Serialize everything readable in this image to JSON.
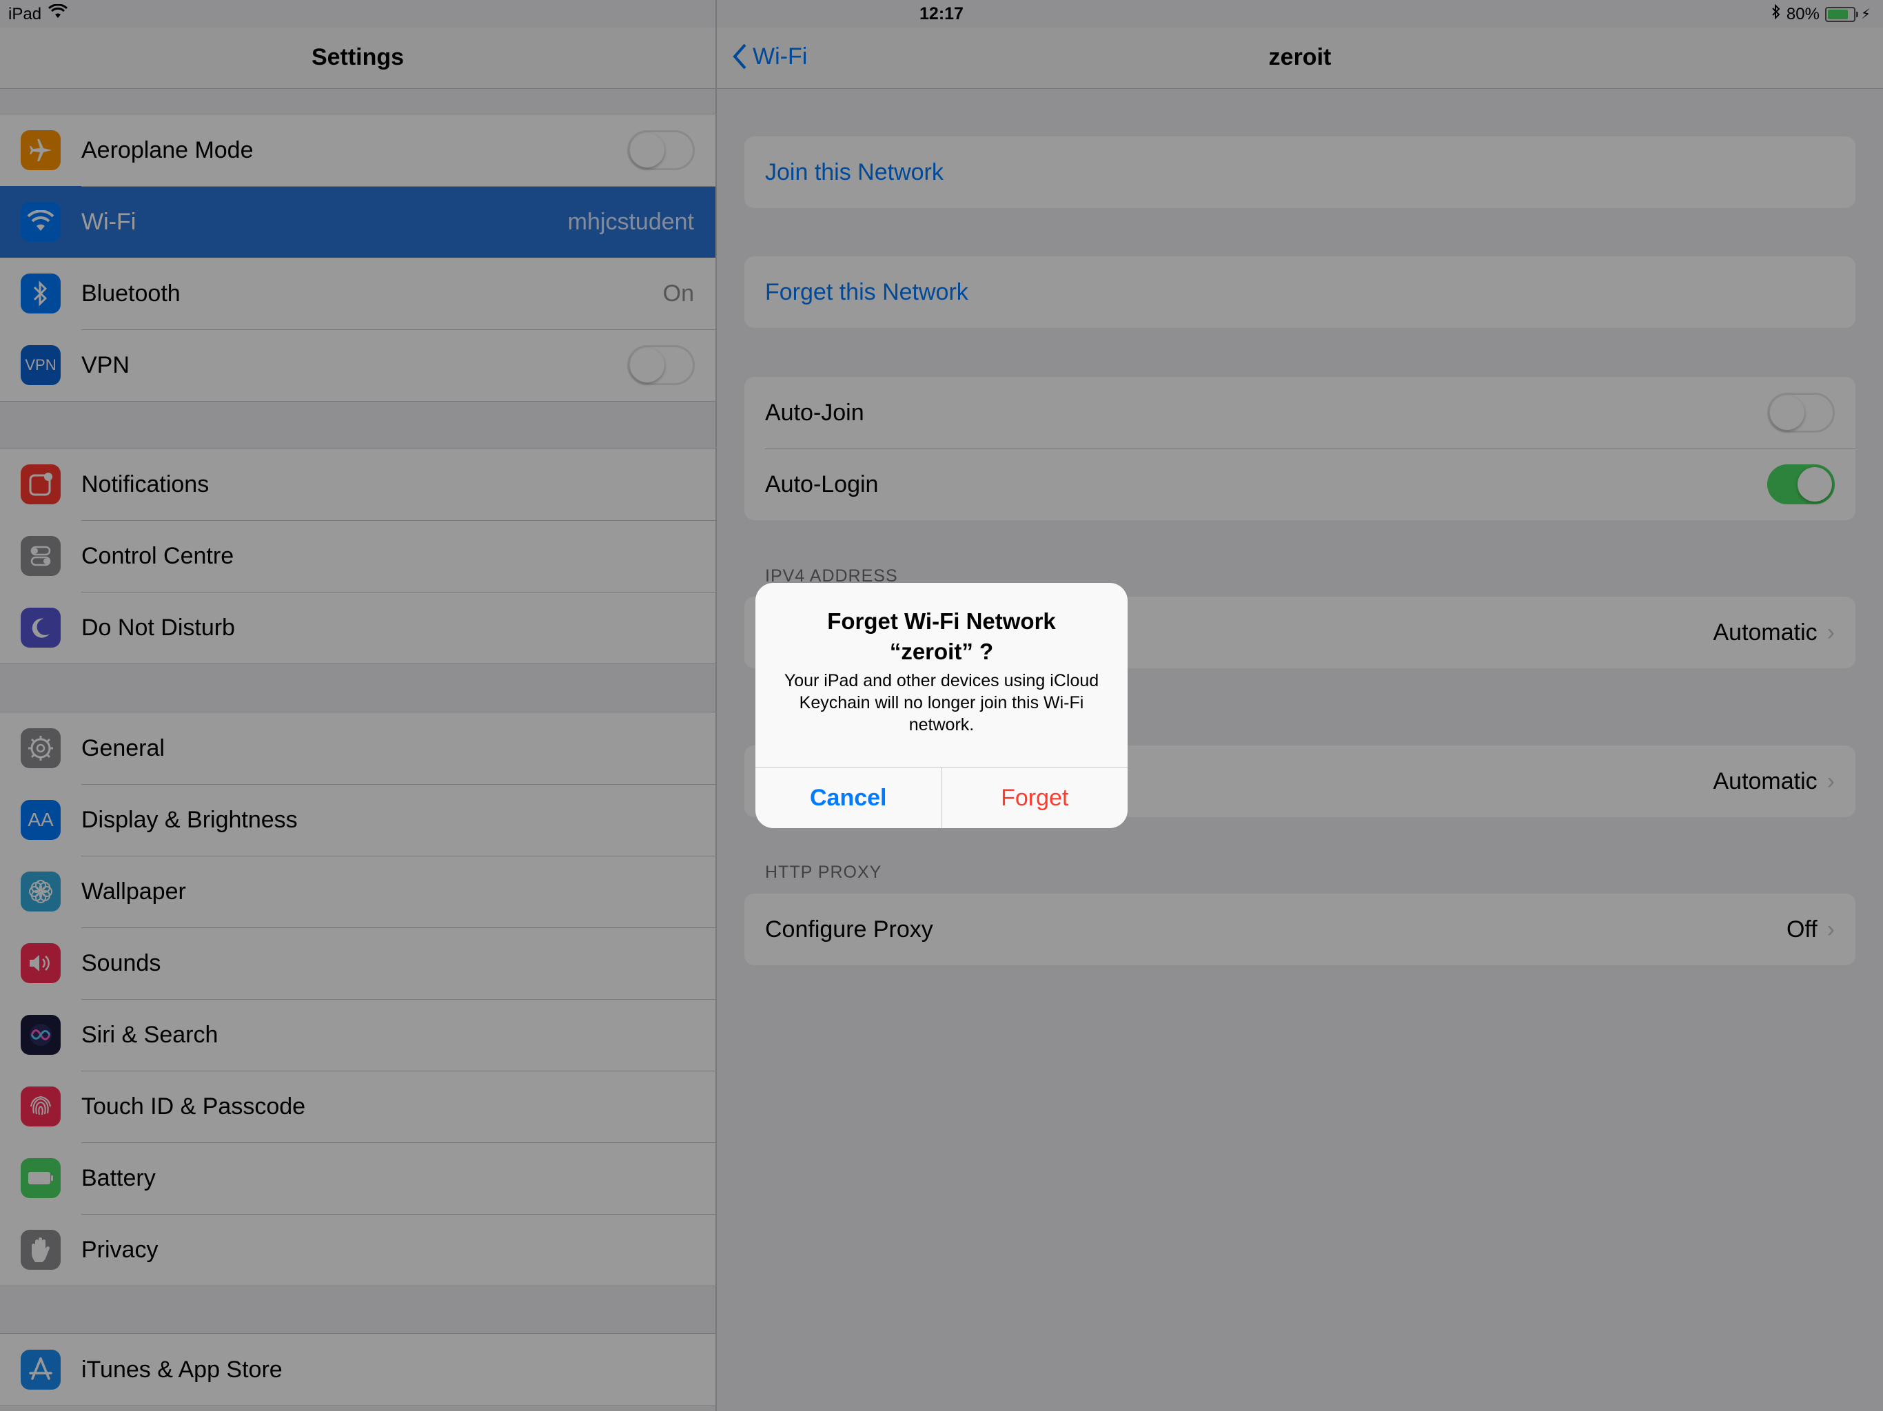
{
  "status": {
    "device": "iPad",
    "time": "12:17",
    "battery": "80%",
    "battery_fraction": 0.8
  },
  "master": {
    "title": "Settings",
    "groups": [
      [
        {
          "label": "Aeroplane Mode",
          "control": "toggle",
          "on": false,
          "icon": "airplane-icon",
          "color": "#ff9500"
        },
        {
          "label": "Wi-Fi",
          "value": "mhjcstudent",
          "selected": true,
          "icon": "wifi-icon",
          "color": "#007aff"
        },
        {
          "label": "Bluetooth",
          "value": "On",
          "icon": "bluetooth-icon",
          "color": "#007aff"
        },
        {
          "label": "VPN",
          "control": "toggle",
          "on": false,
          "icon": "vpn-icon",
          "icon_text": "VPN",
          "color": "#0a63d6"
        }
      ],
      [
        {
          "label": "Notifications",
          "icon": "notifications-icon",
          "color": "#ff3b30"
        },
        {
          "label": "Control Centre",
          "icon": "control-centre-icon",
          "color": "#8e8e93"
        },
        {
          "label": "Do Not Disturb",
          "icon": "moon-icon",
          "color": "#5856d6"
        }
      ],
      [
        {
          "label": "General",
          "icon": "gear-icon",
          "color": "#8e8e93"
        },
        {
          "label": "Display & Brightness",
          "icon": "display-icon",
          "icon_text": "AA",
          "color": "#007aff"
        },
        {
          "label": "Wallpaper",
          "icon": "wallpaper-icon",
          "color": "#34aadc"
        },
        {
          "label": "Sounds",
          "icon": "speaker-icon",
          "color": "#ff2d55"
        },
        {
          "label": "Siri & Search",
          "icon": "siri-icon",
          "color": "#1c1c3c"
        },
        {
          "label": "Touch ID & Passcode",
          "icon": "fingerprint-icon",
          "color": "#ff2d55"
        },
        {
          "label": "Battery",
          "icon": "battery-icon",
          "color": "#4cd964"
        },
        {
          "label": "Privacy",
          "icon": "hand-icon",
          "color": "#8e8e93"
        }
      ],
      [
        {
          "label": "iTunes & App Store",
          "icon": "app-store-icon",
          "color": "#1a8cf0"
        }
      ]
    ]
  },
  "detail": {
    "back_label": "Wi-Fi",
    "title": "zeroit",
    "join": "Join this Network",
    "forget": "Forget this Network",
    "auto_join": {
      "label": "Auto-Join",
      "on": false
    },
    "auto_login": {
      "label": "Auto-Login",
      "on": true
    },
    "ipv4_header": "IPV4 ADDRESS",
    "ipv4_value": "Automatic",
    "dns_value": "Automatic",
    "http_header": "HTTP PROXY",
    "proxy": {
      "label": "Configure Proxy",
      "value": "Off"
    }
  },
  "alert": {
    "title_line1": "Forget Wi-Fi Network",
    "title_line2": "“zeroit” ?",
    "message": "Your iPad and other devices using iCloud Keychain will no longer join this Wi-Fi network.",
    "cancel": "Cancel",
    "confirm": "Forget"
  }
}
